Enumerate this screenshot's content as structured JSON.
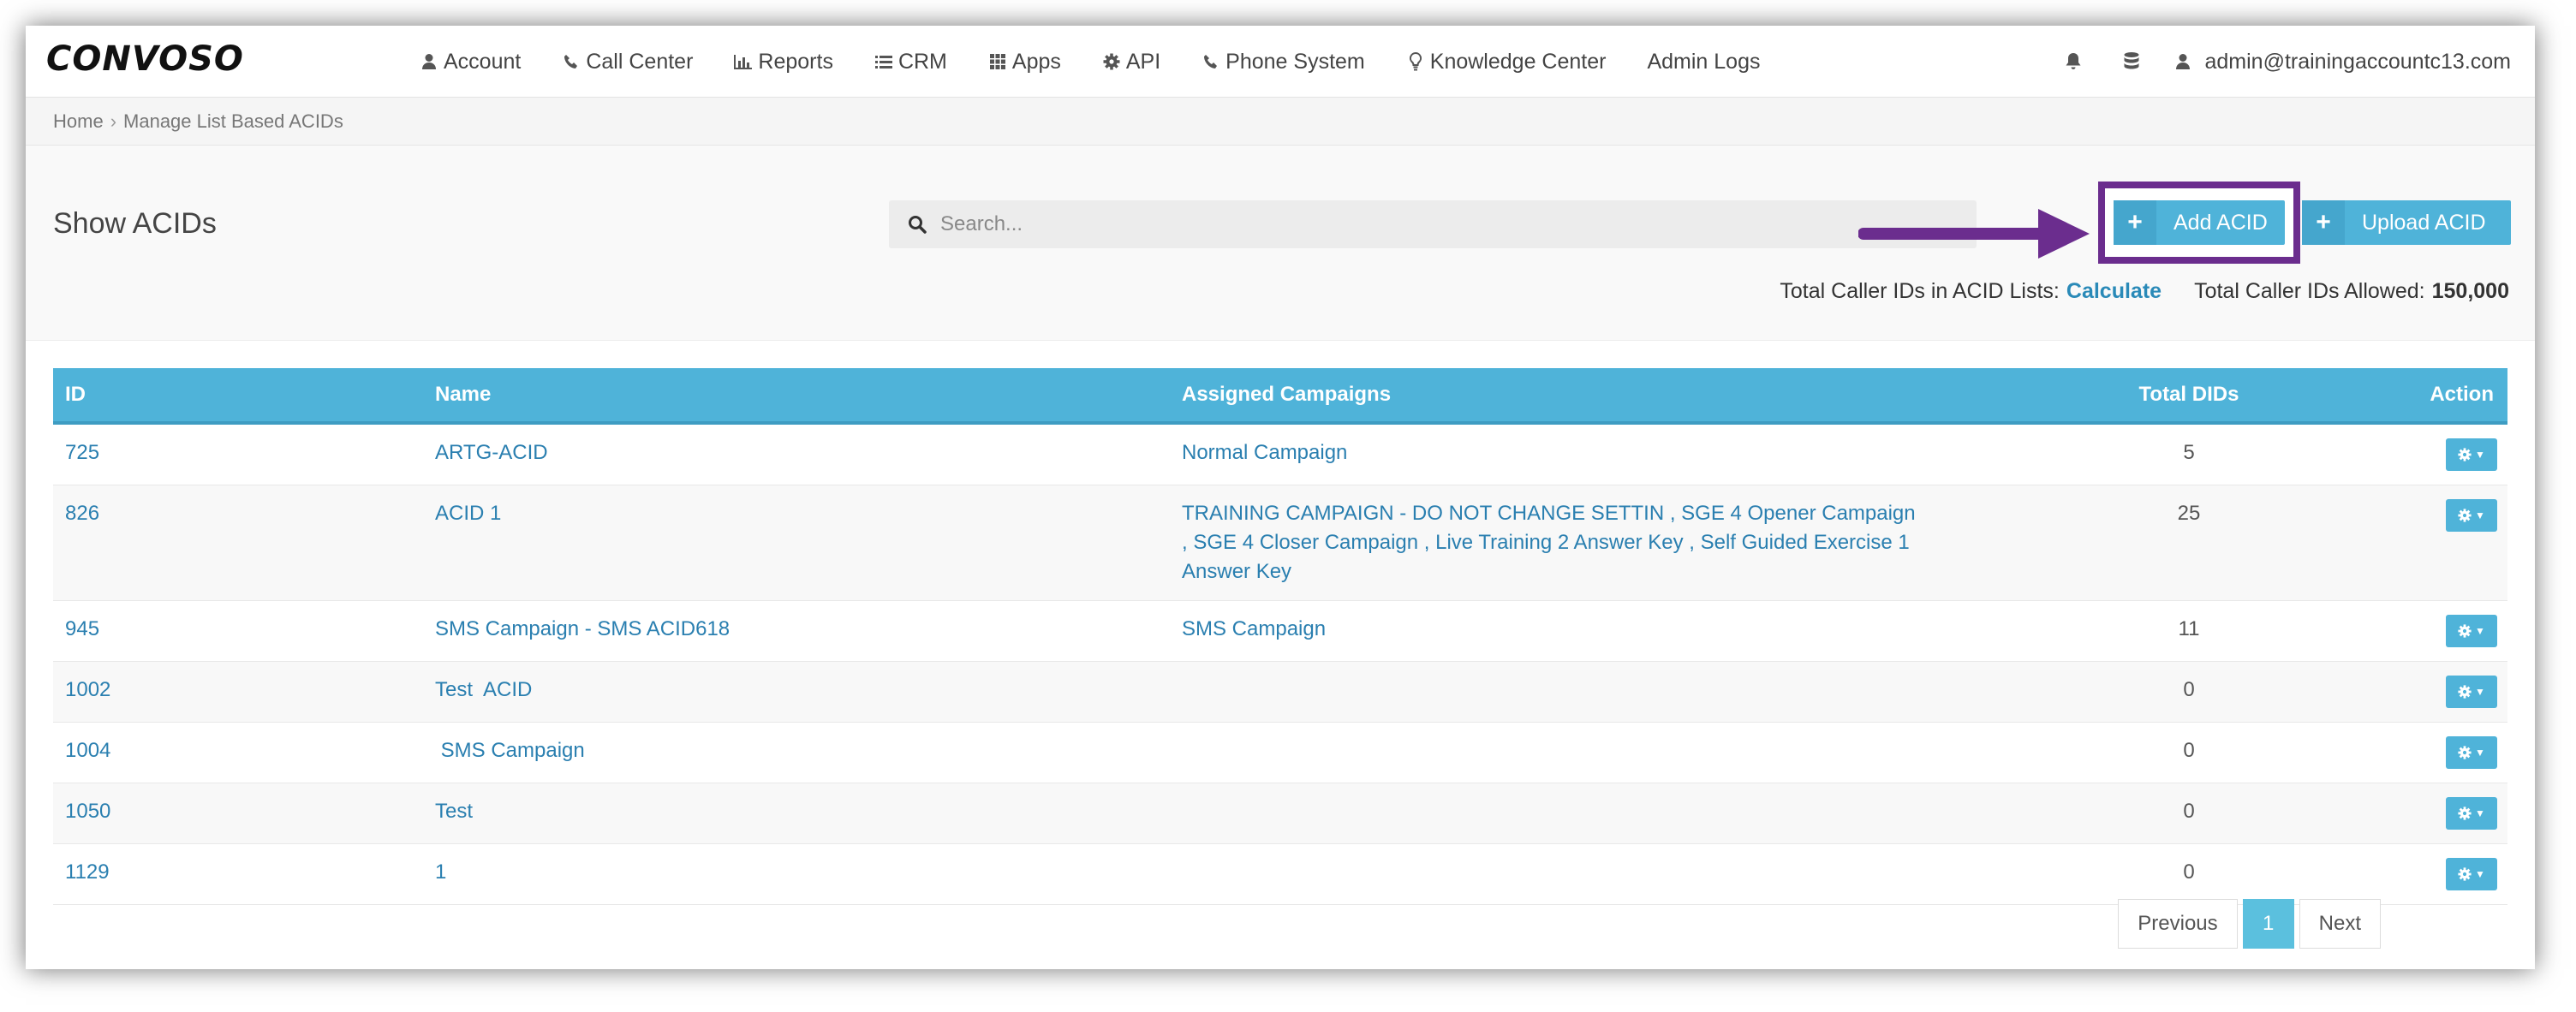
{
  "app": {
    "logo": "CONVOSO"
  },
  "nav": {
    "items": [
      {
        "label": "Account",
        "icon": "user-icon"
      },
      {
        "label": "Call Center",
        "icon": "phone-icon"
      },
      {
        "label": "Reports",
        "icon": "bar-chart-icon"
      },
      {
        "label": "CRM",
        "icon": "list-icon"
      },
      {
        "label": "Apps",
        "icon": "grid-icon"
      },
      {
        "label": "API",
        "icon": "gear-icon"
      },
      {
        "label": "Phone System",
        "icon": "phone-icon"
      },
      {
        "label": "Knowledge Center",
        "icon": "lightbulb-icon"
      },
      {
        "label": "Admin Logs",
        "icon": ""
      }
    ],
    "user": "admin@trainingaccountc13.com"
  },
  "breadcrumb": {
    "home": "Home",
    "separator": "›",
    "current": "Manage List Based ACIDs"
  },
  "page": {
    "title": "Show ACIDs",
    "search_placeholder": "Search...",
    "add_label": "Add ACID",
    "upload_label": "Upload ACID",
    "plus": "+",
    "totals_label": "Total Caller IDs in ACID Lists:",
    "calculate": "Calculate",
    "allowed_label": "Total Caller IDs Allowed:",
    "allowed_value": "150,000"
  },
  "table": {
    "headers": {
      "id": "ID",
      "name": "Name",
      "campaigns": "Assigned Campaigns",
      "total": "Total DIDs",
      "action": "Action"
    },
    "rows": [
      {
        "id": "725",
        "name": "ARTG-ACID",
        "campaigns": "Normal Campaign",
        "total": "5"
      },
      {
        "id": "826",
        "name": "ACID 1",
        "campaigns": "TRAINING CAMPAIGN - DO NOT CHANGE SETTIN , SGE 4 Opener Campaign , SGE 4 Closer Campaign , Live Training 2 Answer Key , Self Guided Exercise 1 Answer Key",
        "total": "25"
      },
      {
        "id": "945",
        "name": "SMS Campaign - SMS ACID618",
        "campaigns": "SMS Campaign",
        "total": "11"
      },
      {
        "id": "1002",
        "name": "Test  ACID",
        "campaigns": "",
        "total": "0"
      },
      {
        "id": "1004",
        "name": " SMS Campaign",
        "campaigns": "",
        "total": "0"
      },
      {
        "id": "1050",
        "name": "Test",
        "campaigns": "",
        "total": "0"
      },
      {
        "id": "1129",
        "name": "1",
        "campaigns": "",
        "total": "0"
      }
    ]
  },
  "pagination": {
    "previous": "Previous",
    "current": "1",
    "next": "Next"
  },
  "colors": {
    "accent": "#4fb3d9",
    "highlight_box": "#6b2d8e",
    "link": "#2a7fb0"
  }
}
